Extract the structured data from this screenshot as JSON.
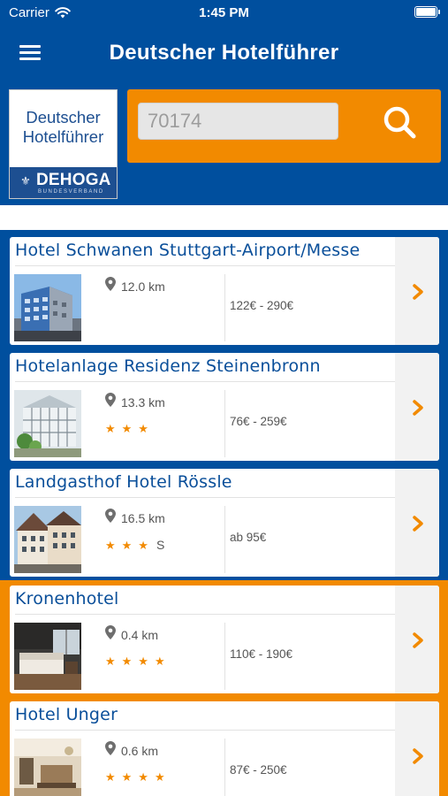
{
  "status_bar": {
    "carrier": "Carrier",
    "time": "1:45 PM"
  },
  "nav": {
    "title": "Deutscher Hotelführer"
  },
  "logo": {
    "line1": "Deutscher",
    "line2": "Hotelführer",
    "brand": "DEHOGA",
    "sub": "BUNDESVERBAND"
  },
  "search": {
    "value": "",
    "placeholder": "70174"
  },
  "colors": {
    "primary_blue": "#004f9e",
    "accent_orange": "#f28a00"
  },
  "hotels": [
    {
      "name": "Hotel Schwanen Stuttgart-Airport/Messe",
      "distance": "12.0 km",
      "stars": "",
      "stars_suffix": "",
      "price": "122€ - 290€"
    },
    {
      "name": "Hotelanlage Residenz Steinenbronn",
      "distance": "13.3 km",
      "stars": "★★★",
      "stars_suffix": "",
      "price": "76€ - 259€"
    },
    {
      "name": "Landgasthof Hotel Rössle",
      "distance": "16.5 km",
      "stars": "★★★",
      "stars_suffix": "S",
      "price": "ab 95€"
    },
    {
      "name": "Kronenhotel",
      "distance": "0.4 km",
      "stars": "★★★★",
      "stars_suffix": "",
      "price": "110€ - 190€"
    },
    {
      "name": "Hotel Unger",
      "distance": "0.6 km",
      "stars": "★★★★",
      "stars_suffix": "",
      "price": "87€ - 250€"
    }
  ]
}
